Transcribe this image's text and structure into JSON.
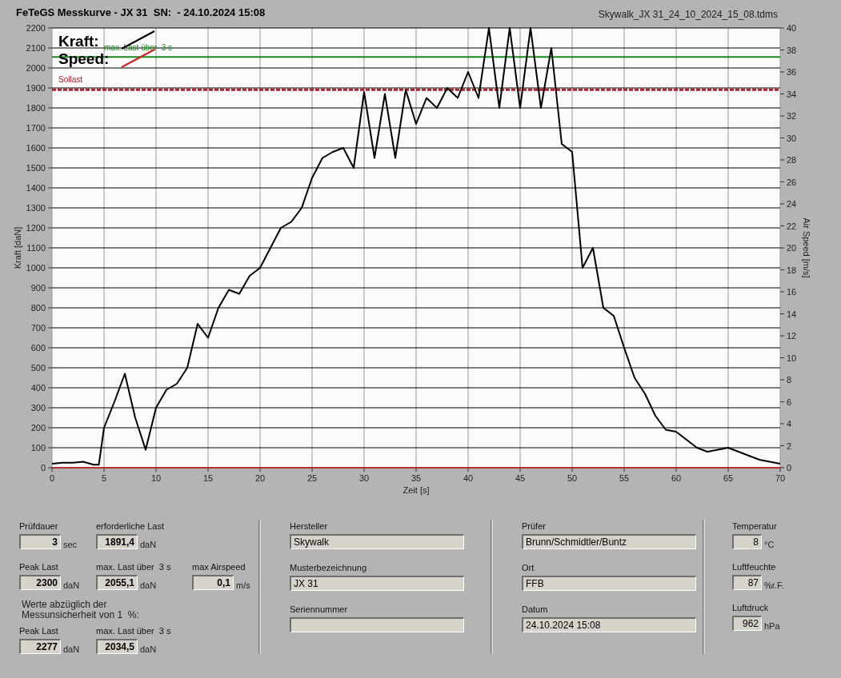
{
  "title": "FeTeGS Messkurve - JX 31  SN:  - 24.10.2024 15:08",
  "file_name": "Skywalk_JX 31_24_10_2024_15_08.tdms",
  "chart": {
    "right_axis": {
      "label": "Air Speed [m/s]",
      "ticks": [
        "40",
        "38",
        "36",
        "34",
        "32",
        "30",
        "28",
        "26",
        "24",
        "22",
        "20",
        "18",
        "16",
        "14",
        "12",
        "10",
        "8",
        "6",
        "4",
        "2",
        "0"
      ]
    },
    "chart_data": {
      "type": "line",
      "xlabel": "Zeit [s]",
      "ylabel": "Kraft [daN]",
      "x": [
        0,
        1,
        2,
        3,
        4,
        4.5,
        5,
        6,
        7,
        8,
        9,
        10,
        11,
        12,
        13,
        14,
        15,
        16,
        17,
        18,
        19,
        20,
        21,
        22,
        23,
        24,
        25,
        26,
        27,
        28,
        29,
        30,
        31,
        32,
        33,
        34,
        35,
        36,
        37,
        38,
        39,
        40,
        41,
        42,
        43,
        44,
        45,
        46,
        47,
        48,
        49,
        50,
        51,
        52,
        53,
        54,
        55,
        56,
        57,
        58,
        59,
        60,
        61,
        62,
        63,
        64,
        65,
        66,
        67,
        68,
        69,
        70
      ],
      "series": [
        {
          "name": "Kraft:",
          "color": "#000000",
          "values": [
            20,
            25,
            25,
            30,
            15,
            15,
            200,
            330,
            470,
            250,
            90,
            300,
            390,
            420,
            500,
            720,
            650,
            800,
            890,
            870,
            960,
            1000,
            1100,
            1200,
            1230,
            1300,
            1450,
            1550,
            1580,
            1600,
            1500,
            1880,
            1550,
            1870,
            1550,
            1890,
            1720,
            1850,
            1800,
            1900,
            1850,
            1980,
            1850,
            2200,
            1800,
            2200,
            1800,
            2200,
            1800,
            2100,
            1620,
            1580,
            1000,
            1100,
            800,
            760,
            600,
            450,
            370,
            260,
            190,
            180,
            140,
            100,
            80,
            90,
            100,
            80,
            60,
            40,
            30,
            20
          ]
        },
        {
          "name": "Speed:",
          "color": "#cc2222",
          "values": [
            0,
            0,
            0,
            0,
            0,
            0,
            0,
            0,
            0,
            0,
            0,
            0,
            0,
            0,
            0,
            0,
            0,
            0,
            0,
            0,
            0,
            0,
            0,
            0,
            0,
            0,
            0,
            0,
            0,
            0,
            0,
            0,
            0,
            0,
            0,
            0,
            0,
            0,
            0,
            0,
            0,
            0,
            0,
            0,
            0,
            0,
            0,
            0,
            0,
            0,
            0,
            0,
            0,
            0,
            0,
            0,
            0,
            0,
            0,
            0,
            0,
            0,
            0,
            0,
            0,
            0,
            0,
            0,
            0,
            0,
            0,
            0
          ]
        }
      ],
      "xlim": [
        0,
        70
      ],
      "ylim": [
        0,
        2200
      ],
      "xticks": [
        0,
        5,
        10,
        15,
        20,
        25,
        30,
        35,
        40,
        45,
        50,
        55,
        60,
        65,
        70
      ],
      "yticks": [
        0,
        100,
        200,
        300,
        400,
        500,
        600,
        700,
        800,
        900,
        1000,
        1100,
        1200,
        1300,
        1400,
        1500,
        1600,
        1700,
        1800,
        1900,
        2000,
        2100,
        2200
      ],
      "grid": true,
      "legend": true,
      "ref_lines": [
        {
          "axis": "y",
          "value": 2055.1,
          "label": "max. Last über  3 s",
          "color": "#1a8a1a"
        },
        {
          "axis": "y",
          "value": 1891.4,
          "label": "Sollast",
          "color": "#b02030"
        }
      ]
    }
  },
  "results": {
    "rows": [
      [
        {
          "label": "Prüfdauer",
          "value": "3",
          "unit": "sec"
        },
        {
          "label": "erforderliche Last",
          "value": "1891,4",
          "unit": "daN"
        }
      ],
      [
        {
          "label": "Peak Last",
          "value": "2300",
          "unit": "daN"
        },
        {
          "label": "max. Last über  3 s",
          "value": "2055,1",
          "unit": "daN"
        },
        {
          "label": "max Airspeed",
          "value": "0,1",
          "unit": "m/s"
        }
      ]
    ],
    "note_lines": [
      "Werte abzüglich der",
      "Messunsicherheit von 1  %:"
    ],
    "corrected": [
      {
        "label": "Peak Last",
        "value": "2277",
        "unit": "daN"
      },
      {
        "label": "max. Last über  3 s",
        "value": "2034,5",
        "unit": "daN"
      }
    ]
  },
  "test_info": [
    [
      {
        "label": "Hersteller",
        "value": "Skywalk"
      },
      {
        "label": "Musterbezeichnung",
        "value": "JX 31"
      },
      {
        "label": "Seriennummer"
      }
    ],
    [
      {
        "label": "Prüfer",
        "value": "Brunn/Schmidtler/Buntz"
      },
      {
        "label": "Ort",
        "value": "FFB"
      },
      {
        "label": "Datum",
        "value": "24.10.2024 15:08"
      }
    ]
  ],
  "conditions": [
    {
      "label": "Temperatur",
      "value": "8",
      "unit": "°C"
    },
    {
      "label": "Luftfeuchte",
      "value": "87",
      "unit": "%r.F."
    },
    {
      "label": "Luftdruck",
      "value": "962",
      "unit": "hPa"
    }
  ]
}
